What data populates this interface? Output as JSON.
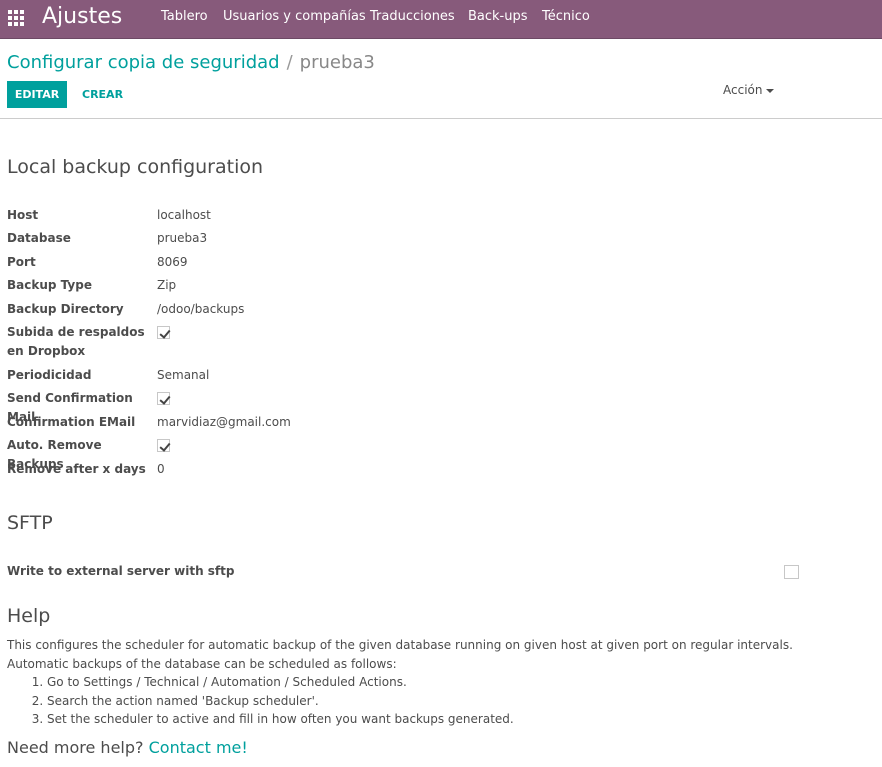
{
  "topbar": {
    "app_title": "Ajustes",
    "menu": [
      "Tablero",
      "Usuarios y compañías",
      "Traducciones",
      "Back-ups",
      "Técnico"
    ]
  },
  "breadcrumb": {
    "parent": "Configurar copia de seguridad",
    "separator": "/",
    "current": "prueba3"
  },
  "buttons": {
    "edit": "EDITAR",
    "create": "CREAR",
    "action": "Acción"
  },
  "local": {
    "title": "Local backup configuration",
    "fields": [
      {
        "label": "Host",
        "value": "localhost"
      },
      {
        "label": "Database",
        "value": "prueba3"
      },
      {
        "label": "Port",
        "value": "8069"
      },
      {
        "label": "Backup Type",
        "value": "Zip"
      },
      {
        "label": "Backup Directory",
        "value": "/odoo/backups"
      },
      {
        "label": "Subida de respaldos en Dropbox",
        "checked": true
      },
      {
        "label": "Periodicidad",
        "value": "Semanal"
      },
      {
        "label": "Send Confirmation Mail",
        "checked": true
      },
      {
        "label": "Confirmation EMail",
        "value": "marvidiaz@gmail.com"
      },
      {
        "label": "Auto. Remove Backups",
        "checked": true
      },
      {
        "label": "Remove after x days",
        "value": "0"
      }
    ]
  },
  "sftp": {
    "title": "SFTP",
    "write_label": "Write to external server with sftp",
    "write_checked": false
  },
  "help": {
    "title": "Help",
    "line1": "This configures the scheduler for automatic backup of the given database running on given host at given port on regular intervals.",
    "line2": "Automatic backups of the database can be scheduled as follows:",
    "steps": [
      "Go to Settings / Technical / Automation / Scheduled Actions.",
      "Search the action named 'Backup scheduler'.",
      "Set the scheduler to active and fill in how often you want backups generated."
    ],
    "more_prefix": "Need more help?",
    "more_link": "Contact me!"
  },
  "colors": {
    "brand": "#875a7b",
    "accent": "#00a09d"
  }
}
